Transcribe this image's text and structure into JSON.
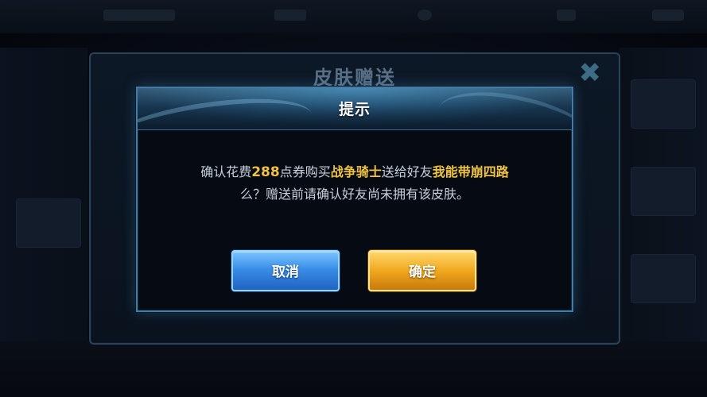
{
  "background_panel": {
    "title": "皮肤赠送",
    "close_glyph": "✖"
  },
  "dialog": {
    "title": "提示",
    "message": {
      "p1": "确认花费",
      "price": "288",
      "p2": "点券购买",
      "skin_name": "战争骑士",
      "p3": "送给好友",
      "friend_name": "我能带崩四路",
      "line2": "么？赠送前请确认好友尚未拥有该皮肤。"
    },
    "cancel_label": "取消",
    "confirm_label": "确定"
  },
  "colors": {
    "highlight": "#f0c341",
    "cancel_button": "#3a8ee6",
    "confirm_button": "#f0a81e",
    "dialog_border": "#3f7ea6"
  }
}
